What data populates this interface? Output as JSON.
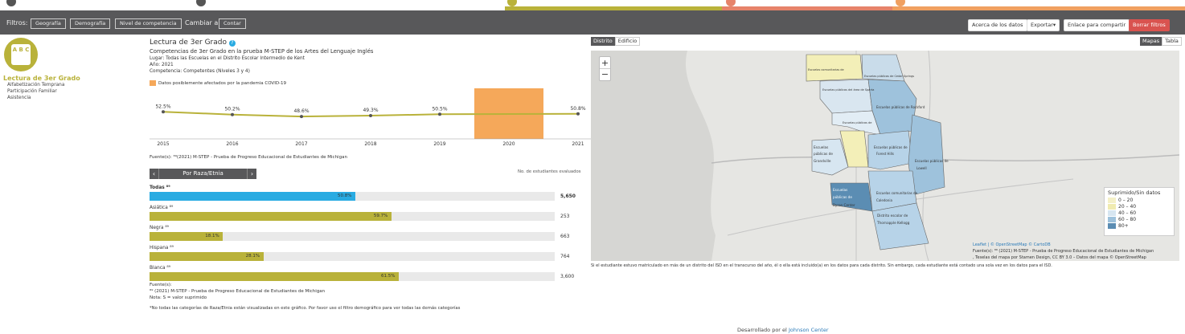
{
  "colors": {
    "accent": "#b9b23a",
    "bar_total": "#29abe2",
    "bar_group": "#b9b23a",
    "covid": "#f5a85a",
    "filterbar": "#58585a",
    "danger": "#d9534f",
    "map_low": "#e9f1f7",
    "map_mid": "#b7d3e8",
    "map_high": "#8fb6d6",
    "map_top": "#5b8db3"
  },
  "filters": {
    "label": "Filtros:",
    "items": [
      "Geografía",
      "Demografía",
      "Nivel de competencia"
    ],
    "change_label": "Cambiar a:",
    "change_btn": "Contar"
  },
  "actions": {
    "about": "Acerca de los datos",
    "export": "Exportar▾",
    "share": "Enlace para compartir",
    "clear": "Borrar filtros"
  },
  "sidebar": {
    "logo_text": "A B C",
    "title": "Lectura de 3er Grado",
    "items": [
      "Alfabetización Temprana",
      "Participación Familiar",
      "Asistencia"
    ]
  },
  "chart": {
    "title": "Lectura de 3er Grado",
    "subtitle": "Competencias de 3er Grado en la prueba M-STEP de los Artes del Lenguaje Inglés",
    "meta": [
      "Lugar: Todas las Escuelas en el Distrito Escolar Intermedio de Kent",
      "Año: 2021",
      "Competencia: Competentes (Niveles 3 y 4)"
    ],
    "covid_legend": "Datos posiblemente afectados por la pandemia COVID-19",
    "source": "Fuente(s): ⁸⁹(2021) M-STEP - Prueba de Progreso Educacional de Estudiantes de Michigan"
  },
  "chart_data": {
    "type": "line",
    "x": [
      "2015",
      "2016",
      "2017",
      "2018",
      "2019",
      "2020",
      "2021"
    ],
    "series": [
      {
        "values": [
          52.5,
          50.2,
          48.6,
          49.3,
          50.5,
          null,
          50.8
        ]
      }
    ],
    "labels": [
      "52.5%",
      "50.2%",
      "48.6%",
      "49.3%",
      "50.5%",
      "",
      "50.8%"
    ],
    "highlight_x": "2020"
  },
  "race": {
    "nav_label": "Por Raza/Etnia",
    "count_header": "No. de estudiantes evaluados",
    "rows": [
      {
        "label": "Todas ⁸⁹",
        "value": 50.8,
        "text": "50.8%",
        "n": "5,650",
        "total": true
      },
      {
        "label": "Asiática ⁸⁹",
        "value": 59.7,
        "text": "59.7%",
        "n": "253",
        "total": false
      },
      {
        "label": "Negra ⁸⁹",
        "value": 18.1,
        "text": "18.1%",
        "n": "663",
        "total": false
      },
      {
        "label": "Hispana ⁸⁹",
        "value": 28.1,
        "text": "28.1%",
        "n": "764",
        "total": false
      },
      {
        "label": "Blanca ⁸⁹",
        "value": 61.5,
        "text": "61.5%",
        "n": "3,600",
        "total": false
      }
    ],
    "source_title": "Fuente(s):",
    "source": "⁸⁹ (2021) M-STEP - Prueba de Progreso Educacional de Estudiantes de Michigan",
    "note": "Nota: S = valor suprimido",
    "footnote": "*No todas las categorías de Raza/Etnia están visualizadas en este gráfico. Por favor use el filtro demográfico para ver todas las demás categorías"
  },
  "map": {
    "tabs": [
      "Distrito",
      "Edificio"
    ],
    "view_tabs": [
      "Mapas",
      "Tabla"
    ],
    "zoom_in": "+",
    "zoom_out": "−",
    "legend_title": "Suprimido/Sin datos",
    "legend": [
      {
        "label": "0 – 20",
        "color": "#f4f0c8"
      },
      {
        "label": "20 – 40",
        "color": "#f0ebb0"
      },
      {
        "label": "40 – 60",
        "color": "#d7e6f1"
      },
      {
        "label": "60 – 80",
        "color": "#9ec2dc"
      },
      {
        "label": "80+",
        "color": "#5b8db3"
      }
    ],
    "regions": [
      "Escuelas comunitarias de",
      "Escuelas públicas de Cedar Springs",
      "Escuelas públicas del área de Sparta",
      "Escuelas públicas de Rockford",
      "Escuelas públicas de",
      "Escuelas",
      "públicas de",
      "Grandville",
      "Escuelas públicas de",
      "Forest Hills",
      "Escuelas públicas de",
      "Lowell",
      "Escuelas",
      "públicas de",
      "Byron Center",
      "Escuelas comunitarias de",
      "Caledonia",
      "Distrito escolar de",
      "Thornapple Kellogg"
    ],
    "attribution": "Leaflet | © OpenStreetMap © CartoDB",
    "source": "Fuente(s): ⁸⁹ (2021) M-STEP - Prueba de Progreso Educacional de Estudiantes de Michigan",
    "tiles": ", Teselas del mapa por Stamen Design, CC BY 3.0 – Datos del mapa © OpenStreetMap",
    "note": "Si el estudiante estuvo matriculado en más de un distrito del ISD en el transcurso del año, él o ella está incluido(a) en los datos para cada distrito. Sin embargo, cada estudiante está contado una sola vez en los datos para el ISD."
  },
  "footer": {
    "text": "Desarrollado por el",
    "link": "Johnson Center"
  }
}
